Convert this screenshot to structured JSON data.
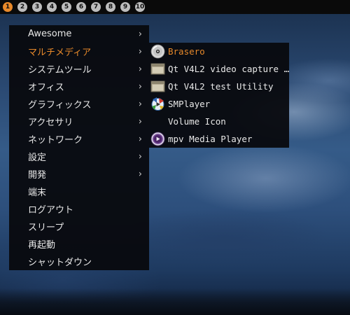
{
  "taskbar": {
    "tags": [
      "1",
      "2",
      "3",
      "4",
      "5",
      "6",
      "7",
      "8",
      "9",
      "10"
    ],
    "active_tag_color": "#e8892a"
  },
  "main_menu": {
    "items": [
      {
        "label": "Awesome",
        "has_submenu": true
      },
      {
        "label": "マルチメディア",
        "has_submenu": true,
        "active": true
      },
      {
        "label": "システムツール",
        "has_submenu": true
      },
      {
        "label": "オフィス",
        "has_submenu": true
      },
      {
        "label": "グラフィックス",
        "has_submenu": true
      },
      {
        "label": "アクセサリ",
        "has_submenu": true
      },
      {
        "label": "ネットワーク",
        "has_submenu": true
      },
      {
        "label": "設定",
        "has_submenu": true
      },
      {
        "label": "開発",
        "has_submenu": true
      },
      {
        "label": "端末",
        "has_submenu": false
      },
      {
        "label": "ログアウト",
        "has_submenu": false
      },
      {
        "label": "スリープ",
        "has_submenu": false
      },
      {
        "label": "再起動",
        "has_submenu": false
      },
      {
        "label": "シャットダウン",
        "has_submenu": false
      }
    ],
    "arrow_glyph": "›"
  },
  "submenu": {
    "items": [
      {
        "label": "Brasero",
        "icon": "disc-icon",
        "active": true
      },
      {
        "label": "Qt V4L2 video capture …",
        "icon": "window-icon"
      },
      {
        "label": "Qt V4L2 test Utility",
        "icon": "window-icon"
      },
      {
        "label": "SMPlayer",
        "icon": "smplayer-icon"
      },
      {
        "label": "Volume Icon",
        "icon": null
      },
      {
        "label": "mpv Media Player",
        "icon": "mpv-icon"
      }
    ]
  },
  "colors": {
    "accent": "#e8892a",
    "menu_bg": "#080a0e",
    "menu_text": "#e8e8e8"
  }
}
